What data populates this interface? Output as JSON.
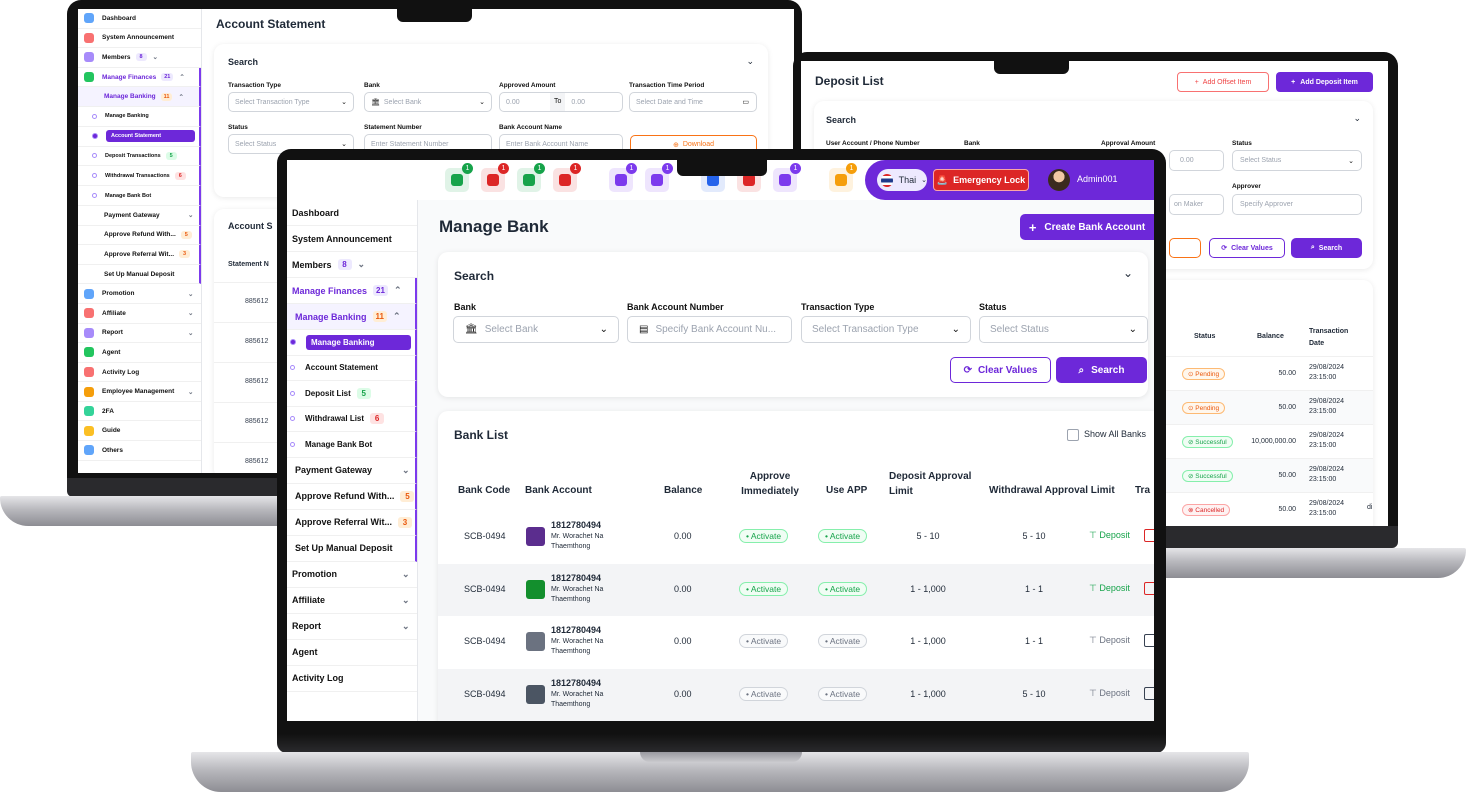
{
  "left": {
    "sidebar": [
      {
        "label": "Dashboard"
      },
      {
        "label": "System Announcement"
      },
      {
        "label": "Members",
        "count": "8"
      },
      {
        "label": "Manage Finances",
        "count": "21"
      },
      {
        "label": "Manage Banking",
        "count": "11"
      },
      {
        "label": "Manage Banking"
      },
      {
        "label": "Account Statement"
      },
      {
        "label": "Deposit Transactions",
        "count": "5"
      },
      {
        "label": "Withdrawal Transactions",
        "count": "6"
      },
      {
        "label": "Manage Bank Bot"
      },
      {
        "label": "Payment Gateway"
      },
      {
        "label": "Approve Refund With...",
        "count": "5"
      },
      {
        "label": "Approve Referral Wit...",
        "count": "3"
      },
      {
        "label": "Set Up Manual Deposit"
      },
      {
        "label": "Promotion"
      },
      {
        "label": "Affiliate"
      },
      {
        "label": "Report"
      },
      {
        "label": "Agent"
      },
      {
        "label": "Activity Log"
      },
      {
        "label": "Employee Management"
      },
      {
        "label": "2FA"
      },
      {
        "label": "Guide"
      },
      {
        "label": "Others"
      }
    ],
    "page_title": "Account Statement",
    "search_title": "Search",
    "labels": {
      "transaction_type": "Transaction Type",
      "bank": "Bank",
      "approved_amount": "Approved Amount",
      "time_period": "Transaction Time Period",
      "status": "Status",
      "statement_number": "Statement Number",
      "account_name": "Bank Account Name"
    },
    "placeholders": {
      "transaction_type": "Select Transaction Type",
      "bank": "Select Bank",
      "amt_from": "0.00",
      "to": "To",
      "amt_to": "0.00",
      "date": "Select Date and Time",
      "status": "Select Status",
      "statement": "Enter Statement Number",
      "account_name": "Enter Bank Account Name"
    },
    "download": "Download",
    "list_title": "Account S",
    "col_statement": "Statement N",
    "rows": [
      "885612",
      "885612",
      "885612",
      "885612",
      "885612"
    ]
  },
  "right": {
    "page_title": "Deposit List",
    "add_offset": "Add Offset Item",
    "add_deposit": "Add Deposit Item",
    "search_title": "Search",
    "labels": {
      "user": "User Account / Phone Number",
      "bank": "Bank",
      "approval_amount": "Approval Amount",
      "status": "Status",
      "approver": "Approver"
    },
    "placeholders": {
      "amount": "0.00",
      "status": "Select Status",
      "decision": "on Maker",
      "approver": "Specify Approver"
    },
    "clear": "Clear Values",
    "search": "Search",
    "cols": {
      "status": "Status",
      "balance": "Balance",
      "date": "Transaction Date"
    },
    "rows": [
      {
        "status": "Pending",
        "type": "pend",
        "balance": "50.00",
        "date": "29/08/2024",
        "time": "23:15:00"
      },
      {
        "status": "Pending",
        "type": "pend",
        "balance": "50.00",
        "date": "29/08/2024",
        "time": "23:15:00"
      },
      {
        "status": "Successful",
        "type": "succ",
        "balance": "10,000,000.00",
        "date": "29/08/2024",
        "time": "23:15:00"
      },
      {
        "status": "Successful",
        "type": "succ",
        "balance": "50.00",
        "date": "29/08/2024",
        "time": "23:15:00"
      },
      {
        "status": "Cancelled",
        "type": "canc",
        "balance": "50.00",
        "date": "29/08/2024",
        "time": "23:15:00"
      }
    ],
    "trail": "di"
  },
  "main": {
    "topbar": {
      "icons": [
        {
          "name": "money-bag-icon",
          "badge": "1",
          "color": "#16a34a"
        },
        {
          "name": "transfer-icon",
          "badge": "1",
          "color": "#dc2626"
        },
        {
          "name": "plant-icon",
          "badge": "1",
          "color": "#16a34a"
        },
        {
          "name": "house-icon",
          "badge": "1",
          "color": "#dc2626"
        },
        {
          "name": "coins-icon",
          "badge": "1",
          "color": "#7c3aed"
        },
        {
          "name": "network-icon",
          "badge": "1",
          "color": "#7c3aed"
        },
        {
          "name": "edit-icon",
          "badge": "",
          "color": "#2563eb"
        },
        {
          "name": "exchange-icon",
          "badge": "",
          "color": "#dc2626"
        },
        {
          "name": "gift-icon",
          "badge": "1",
          "color": "#7c3aed"
        },
        {
          "name": "bell-icon",
          "badge": "1",
          "color": "#f59e0b"
        }
      ],
      "language": "Thai",
      "emergency": "Emergency Lock",
      "user": "Admin001"
    },
    "sidebar": [
      {
        "label": "Dashboard"
      },
      {
        "label": "System Announcement"
      },
      {
        "label": "Members",
        "count": "8"
      },
      {
        "label": "Manage Finances",
        "count": "21"
      },
      {
        "label": "Manage Banking",
        "count": "11"
      },
      {
        "label": "Manage Banking"
      },
      {
        "label": "Account Statement"
      },
      {
        "label": "Deposit List",
        "count": "5"
      },
      {
        "label": "Withdrawal List",
        "count": "6"
      },
      {
        "label": "Manage Bank Bot"
      },
      {
        "label": "Payment Gateway"
      },
      {
        "label": "Approve Refund With...",
        "count": "5"
      },
      {
        "label": "Approve Referral Wit...",
        "count": "3"
      },
      {
        "label": "Set Up Manual Deposit"
      },
      {
        "label": "Promotion"
      },
      {
        "label": "Affiliate"
      },
      {
        "label": "Report"
      },
      {
        "label": "Agent"
      },
      {
        "label": "Activity Log"
      }
    ],
    "page_title": "Manage Bank",
    "create": "Create Bank Account",
    "search": {
      "title": "Search",
      "bank_label": "Bank",
      "bank_ph": "Select Bank",
      "acct_label": "Bank Account Number",
      "acct_ph": "Specify Bank Account Nu...",
      "type_label": "Transaction Type",
      "type_ph": "Select Transaction Type",
      "status_label": "Status",
      "status_ph": "Select Status",
      "clear": "Clear Values",
      "search": "Search"
    },
    "list": {
      "title": "Bank List",
      "show_all": "Show All Banks",
      "cols": [
        "Bank Code",
        "Bank Account",
        "Balance",
        "Approve Immediately",
        "Use APP",
        "Deposit Approval Limit",
        "Withdrawal Approval Limit",
        "Tra"
      ],
      "rows": [
        {
          "code": "SCB-0494",
          "acct": "1812780494",
          "name": "Mr. Worachet Na",
          "name2": "Thaemthong",
          "balance": "0.00",
          "approve": "• Activate",
          "app": "• Activate",
          "dep": "5 - 10",
          "wd": "5 - 10",
          "action": "Deposit",
          "on": true,
          "logo": "#5b2d8e"
        },
        {
          "code": "SCB-0494",
          "acct": "1812780494",
          "name": "Mr. Worachet Na",
          "name2": "Thaemthong",
          "balance": "0.00",
          "approve": "• Activate",
          "app": "• Activate",
          "dep": "1 - 1,000",
          "wd": "1 - 1",
          "action": "Deposit",
          "on": true,
          "logo": "#138f2d"
        },
        {
          "code": "SCB-0494",
          "acct": "1812780494",
          "name": "Mr. Worachet Na",
          "name2": "Thaemthong",
          "balance": "0.00",
          "approve": "• Activate",
          "app": "• Activate",
          "dep": "1 - 1,000",
          "wd": "1 - 1",
          "action": "Deposit",
          "on": false,
          "logo": "#6b7280"
        },
        {
          "code": "SCB-0494",
          "acct": "1812780494",
          "name": "Mr. Worachet Na",
          "name2": "Thaemthong",
          "balance": "0.00",
          "approve": "• Activate",
          "app": "• Activate",
          "dep": "1 - 1,000",
          "wd": "5 - 10",
          "action": "Deposit",
          "on": false,
          "logo": "#4b5563"
        }
      ]
    }
  }
}
